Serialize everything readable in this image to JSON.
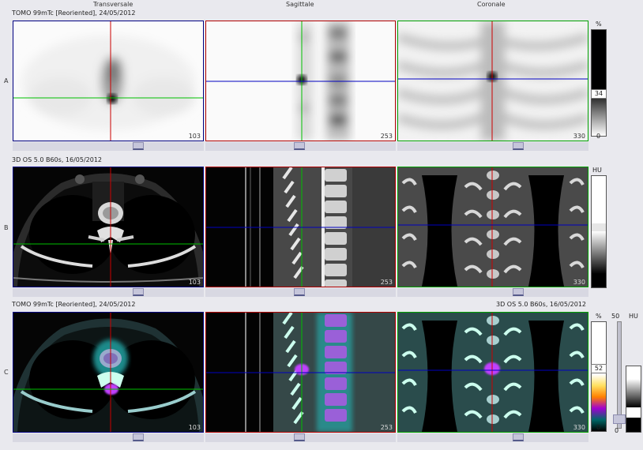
{
  "headers": {
    "transverse": "Transversale",
    "sagittal": "Sagittale",
    "coronal": "Coronale"
  },
  "rows": [
    {
      "letter": "A",
      "title": "TOMO 99mTc [Reoriented], 24/05/2012",
      "slices": [
        "103",
        "253",
        "330"
      ]
    },
    {
      "letter": "B",
      "title": "3D OS 5.0 B60s, 16/05/2012",
      "slices": [
        "103",
        "253",
        "330"
      ]
    },
    {
      "letter": "C",
      "title": "TOMO 99mTc [Reoriented], 24/05/2012",
      "title_right": "3D OS 5.0 B60s, 16/05/2012",
      "slices": [
        "103",
        "253",
        "330"
      ]
    }
  ],
  "scales": {
    "a": {
      "unit": "%",
      "value": "34",
      "min": "0"
    },
    "b": {
      "unit": "HU"
    },
    "c": {
      "unit_pct": "%",
      "value_pct": "52",
      "min_pct": "0",
      "blend_max": "50",
      "blend_min": "0",
      "unit_hu": "HU"
    }
  },
  "colors": {
    "transverse_frame": "#000080",
    "sagittal_frame": "#b00000",
    "coronal_frame": "#00a000",
    "crosshair_red": "#cc0000",
    "crosshair_green": "#00c000",
    "crosshair_blue": "#0000c0"
  }
}
